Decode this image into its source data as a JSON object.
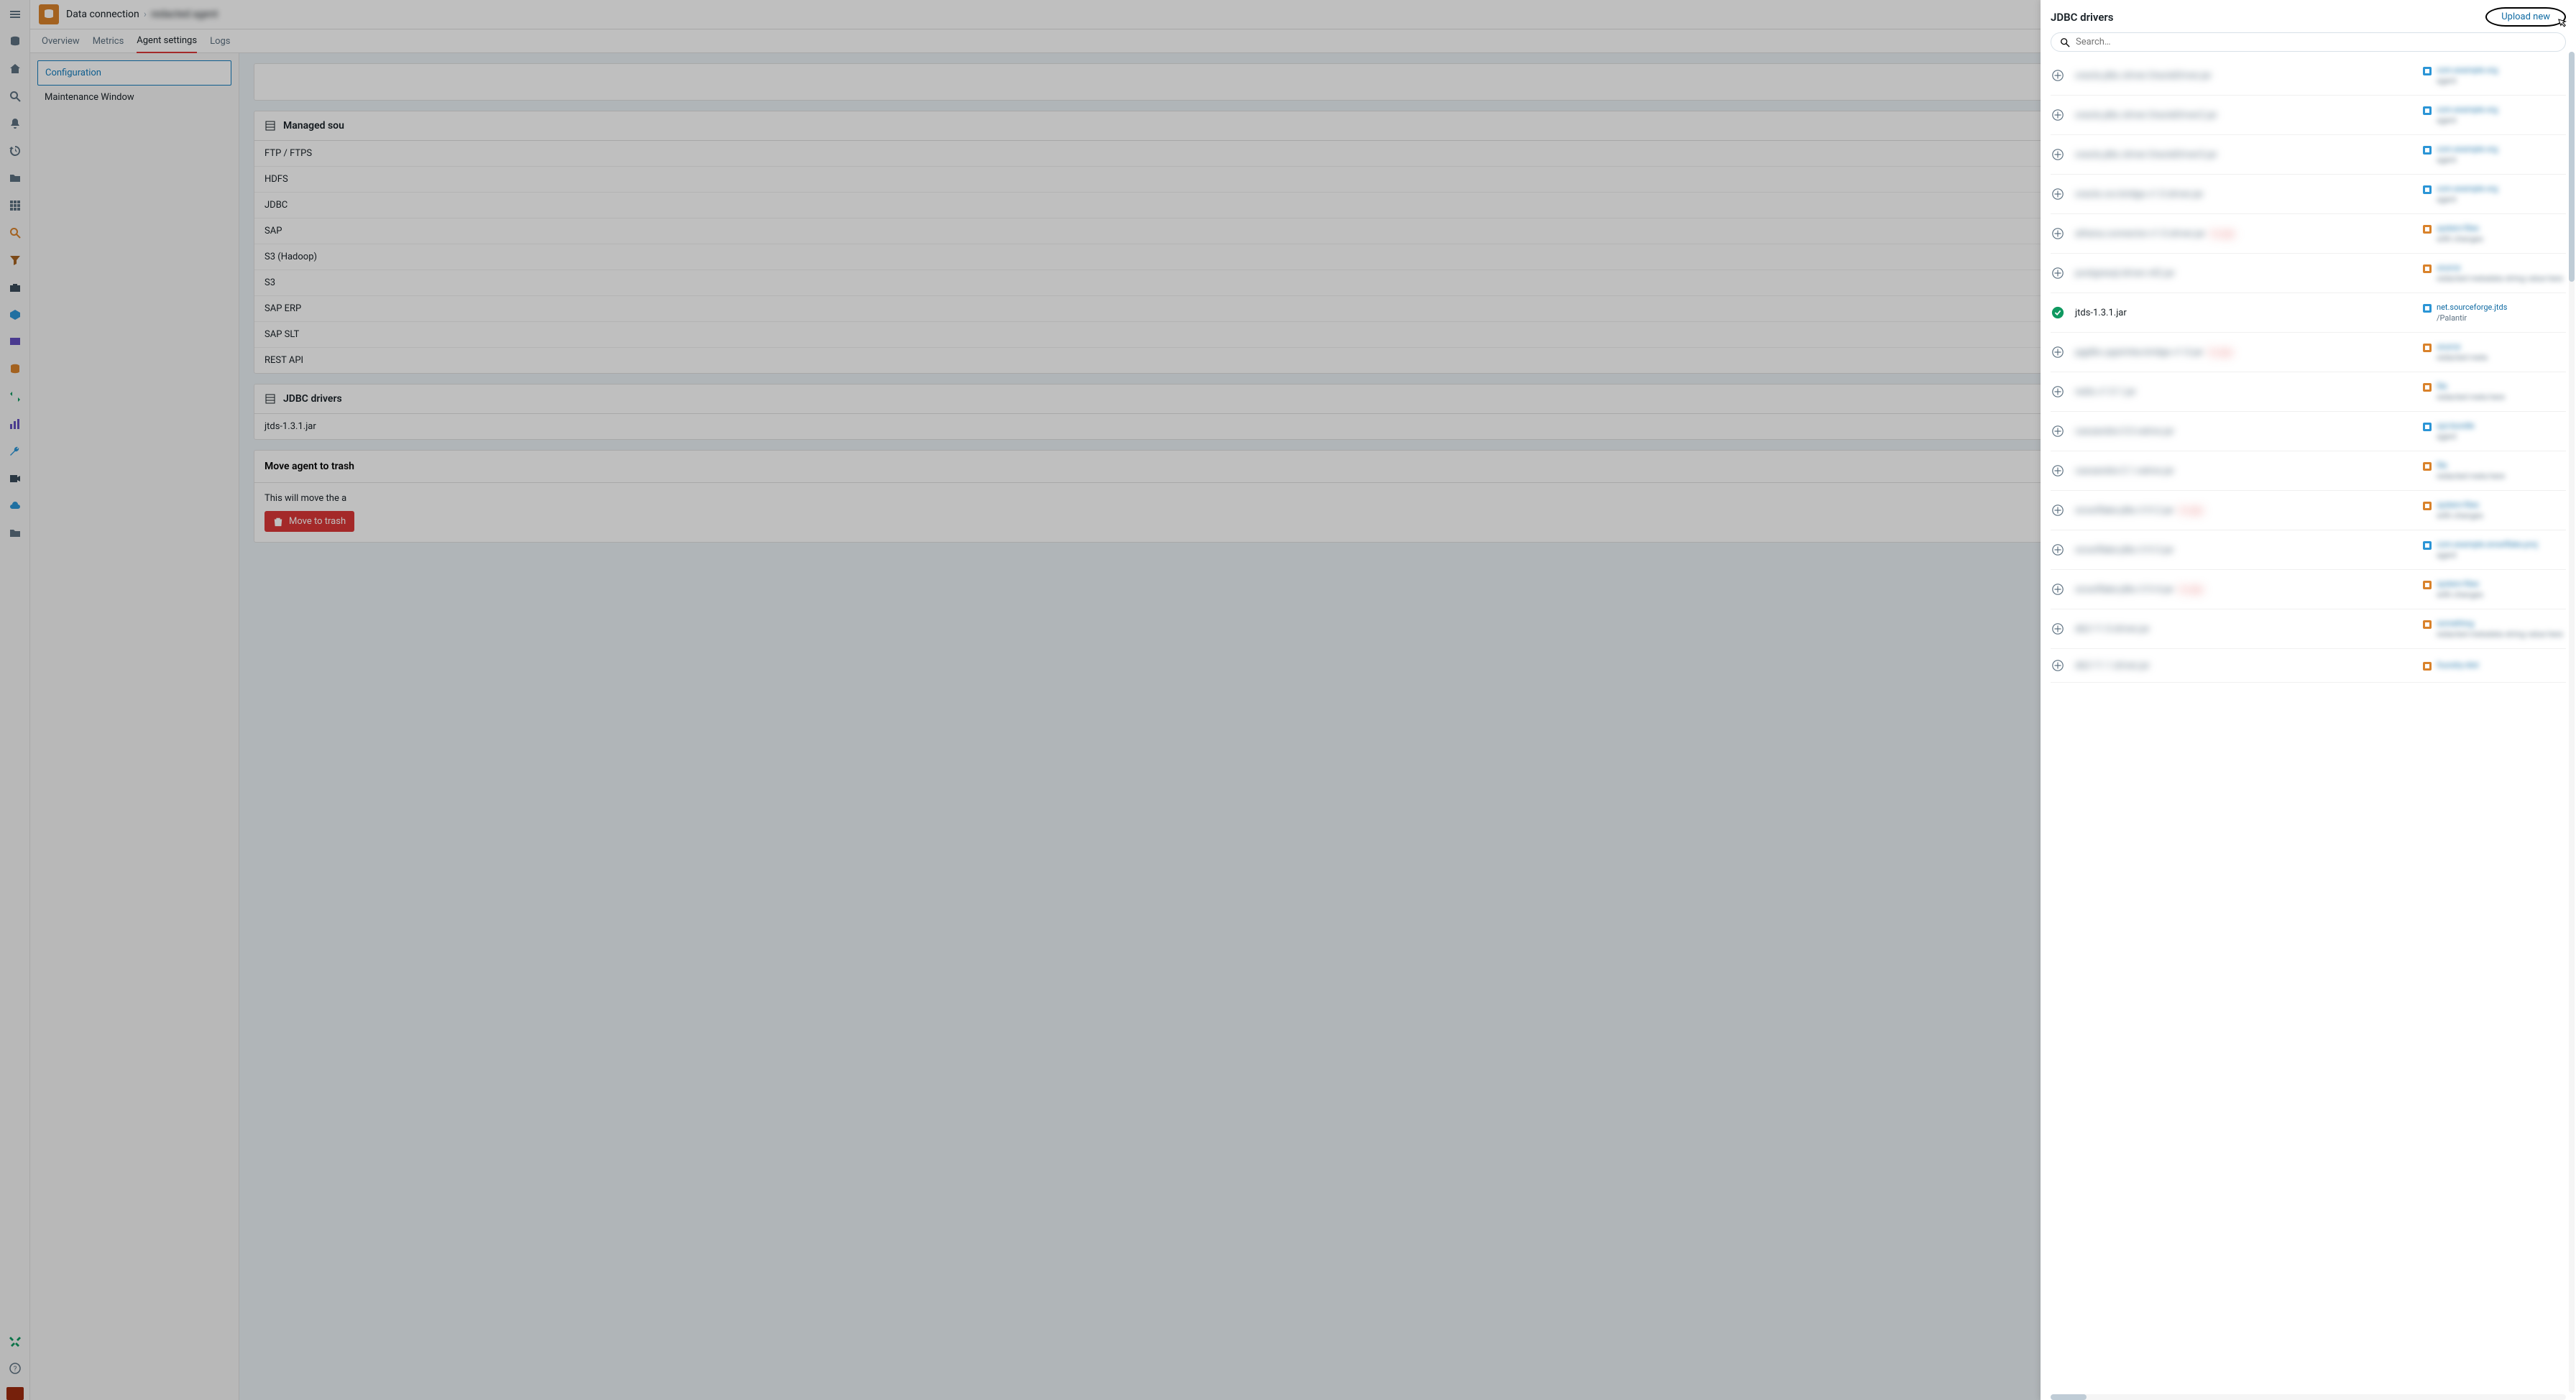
{
  "breadcrumb": {
    "root": "Data connection",
    "current": "redacted agent"
  },
  "tabs": {
    "overview": "Overview",
    "metrics": "Metrics",
    "agent_settings": "Agent settings",
    "logs": "Logs"
  },
  "left_nav": {
    "configuration": "Configuration",
    "maintenance": "Maintenance Window"
  },
  "managed_sources": {
    "title": "Managed sou",
    "items": {
      "ftp": "FTP / FTPS",
      "hdfs": "HDFS",
      "jdbc": "JDBC",
      "sap": "SAP",
      "s3h": "S3 (Hadoop)",
      "s3": "S3",
      "saperp": "SAP ERP",
      "sapslt": "SAP SLT",
      "rest": "REST API"
    }
  },
  "jdbc_card": {
    "title": "JDBC drivers",
    "item": "jtds-1.3.1.jar"
  },
  "trash": {
    "header": "Move agent to trash",
    "body": "This will move the a",
    "button": "Move to trash"
  },
  "panel": {
    "title": "JDBC drivers",
    "upload": "Upload new",
    "search_placeholder": "Search…",
    "selected": {
      "name": "jtds-1.3.1.jar",
      "meta_link": "net.sourceforge.jtds",
      "meta_path": "/Palantir"
    },
    "blur_rows": [
      {
        "name": "oracle.jdbc.driver.OracleDriver.jar",
        "tag": "",
        "icon": "blue",
        "m1": "com.example.org",
        "m2": "agent"
      },
      {
        "name": "oracle.jdbc.driver.OracleDriver2.jar",
        "tag": "",
        "icon": "blue",
        "m1": "com.example.org",
        "m2": "agent"
      },
      {
        "name": "oracle.jdbc.driver.OracleDriver3.jar",
        "tag": "",
        "icon": "blue",
        "m1": "com.example.org",
        "m2": "agent"
      },
      {
        "name": "oracle.csv.bridge.v1.0.driver.jar",
        "tag": "",
        "icon": "blue",
        "m1": "com.example.org",
        "m2": "agent"
      },
      {
        "name": "athena.connector.v1.0.driver.jar",
        "tag": "In use",
        "icon": "orange",
        "m1": "system-files",
        "m2": "with changes"
      },
      {
        "name": "postgresql.driver.v42.jar",
        "tag": "",
        "icon": "orange",
        "m1": "source",
        "m2": "redacted metadata string value here"
      }
    ],
    "blur_rows_after": [
      {
        "name": "pgjdbc.pgsimba.bridge.v1.0.jar",
        "tag": "In use",
        "icon": "orange",
        "m1": "source",
        "m2": "redacted meta"
      },
      {
        "name": "redis.v1.0.1.jar",
        "tag": "",
        "icon": "orange",
        "m1": "file",
        "m2": "redacted meta here"
      },
      {
        "name": "cassandra-3.0.native.jar",
        "tag": "",
        "icon": "blue",
        "m1": "sys-bundle",
        "m2": "agent"
      },
      {
        "name": "cassandra-3.1.native.jar",
        "tag": "",
        "icon": "orange",
        "m1": "file",
        "m2": "redacted meta here"
      },
      {
        "name": "snowflake-jdbc-3.9.2.jar",
        "tag": "In use",
        "icon": "orange",
        "m1": "system-files",
        "m2": "with changes"
      },
      {
        "name": "snowflake-jdbc-3.9.3.jar",
        "tag": "",
        "icon": "blue",
        "m1": "com.example.snowflake.proj",
        "m2": "agent"
      },
      {
        "name": "snowflake-jdbc-3.9.4.jar",
        "tag": "In use",
        "icon": "orange",
        "m1": "system-files",
        "m2": "with changes"
      },
      {
        "name": "db2-11.0.driver.jar",
        "tag": "",
        "icon": "orange",
        "m1": "something",
        "m2": "redacted metadata string value here"
      },
      {
        "name": "db2-11.1.driver.jar",
        "tag": "",
        "icon": "orange",
        "m1": "foundry-dist",
        "m2": ""
      }
    ]
  }
}
